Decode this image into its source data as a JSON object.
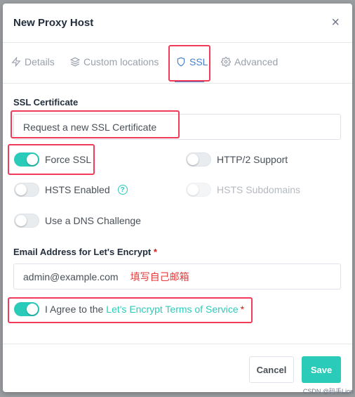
{
  "modal": {
    "title": "New Proxy Host",
    "close_glyph": "×"
  },
  "tabs": [
    {
      "label": "Details",
      "icon": "lightning-icon"
    },
    {
      "label": "Custom locations",
      "icon": "layers-icon"
    },
    {
      "label": "SSL",
      "icon": "shield-icon",
      "active": true
    },
    {
      "label": "Advanced",
      "icon": "gear-icon"
    }
  ],
  "ssl": {
    "certificate_label": "SSL Certificate",
    "certificate_value": "Request a new SSL Certificate",
    "force_ssl": {
      "label": "Force SSL",
      "on": true
    },
    "http2": {
      "label": "HTTP/2 Support",
      "on": false
    },
    "hsts": {
      "label": "HSTS Enabled",
      "on": false,
      "help": "?"
    },
    "hsts_sub": {
      "label": "HSTS Subdomains",
      "on": false,
      "disabled": true
    },
    "dns": {
      "label": "Use a DNS Challenge",
      "on": false
    },
    "email_label": "Email Address for Let's Encrypt",
    "required_mark": "*",
    "email_value": "admin@example.com",
    "email_note": "填写自己邮箱",
    "agree_prefix": "I Agree to the",
    "agree_link": "Let's Encrypt Terms of Service",
    "agree_on": true
  },
  "footer": {
    "cancel_label": "Cancel",
    "save_label": "Save"
  },
  "watermark": "CSDN @码手Lion",
  "colors": {
    "accent": "#2bcbba",
    "tab_active": "#467fcf",
    "highlight": "#f03c5a",
    "note": "#e23a3a"
  }
}
